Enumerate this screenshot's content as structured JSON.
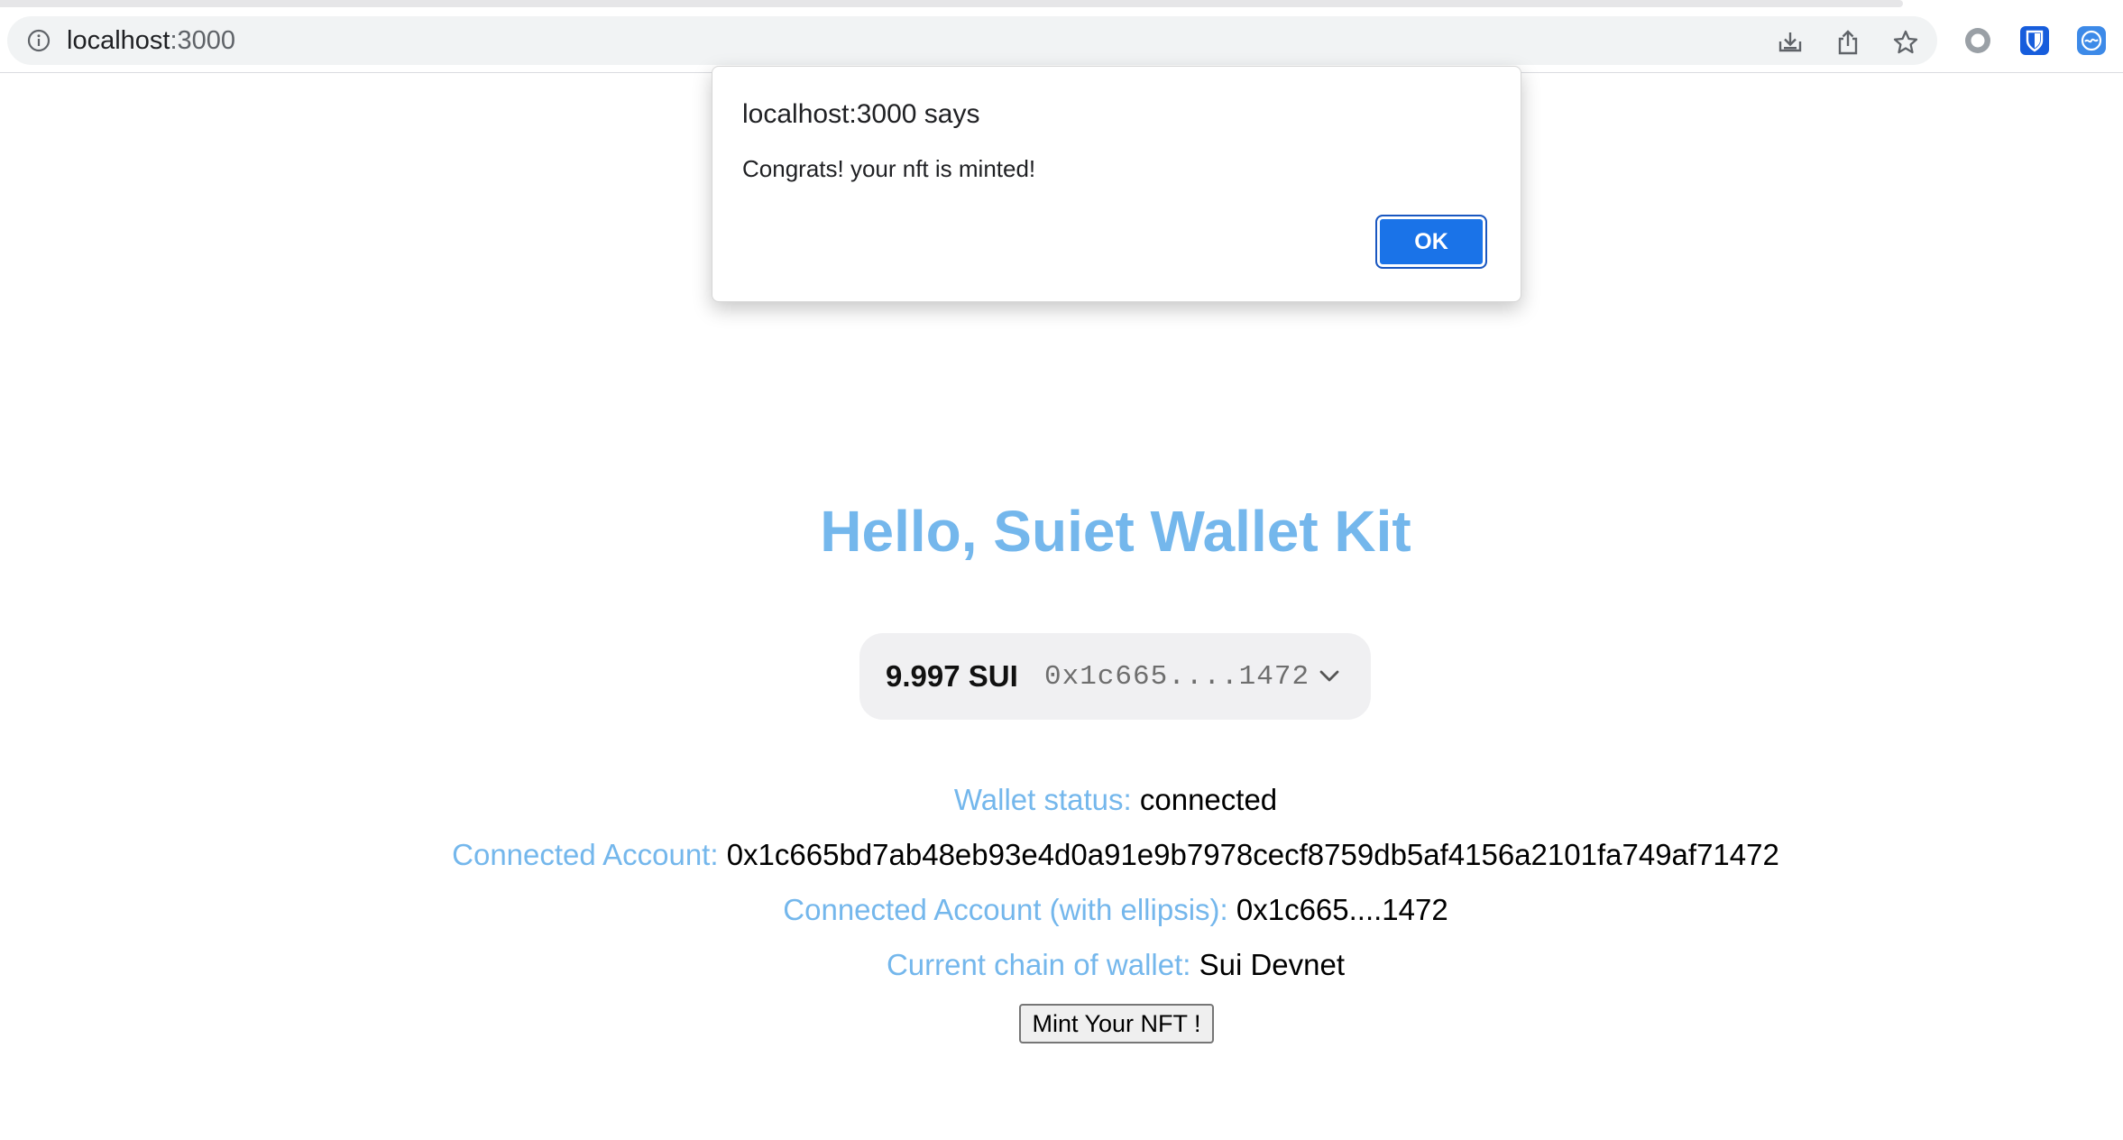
{
  "browser": {
    "url_host": "localhost",
    "url_port": ":3000"
  },
  "dialog": {
    "title": "localhost:3000 says",
    "message": "Congrats! your nft is minted!",
    "ok_label": "OK"
  },
  "page": {
    "heading": "Hello, Suiet Wallet Kit",
    "wallet_button": {
      "balance": "9.997 SUI",
      "address": "0x1c665....1472"
    },
    "info": {
      "status_label": "Wallet status:",
      "status_value": "connected",
      "account_label": "Connected Account:",
      "account_value": "0x1c665bd7ab48eb93e4d0a91e9b7978cecf8759db5af4156a2101fa749af71472",
      "account_ellipsis_label": "Connected Account (with ellipsis):",
      "account_ellipsis_value": "0x1c665....1472",
      "chain_label": "Current chain of wallet:",
      "chain_value": "Sui Devnet"
    },
    "mint_button_label": "Mint Your NFT !"
  },
  "colors": {
    "accent_light_blue": "#74b7ec",
    "dialog_button_blue": "#1a73e8",
    "pill_background": "#f0f0f2"
  },
  "icons": {
    "site_info": "info-circle-icon",
    "install": "install-icon",
    "share": "share-icon",
    "bookmark": "star-icon",
    "extension_1": "circle-extension-icon",
    "extension_2": "bitwarden-shield-icon",
    "extension_3": "wallet-extension-icon",
    "wallet_menu": "chevron-down-icon"
  }
}
